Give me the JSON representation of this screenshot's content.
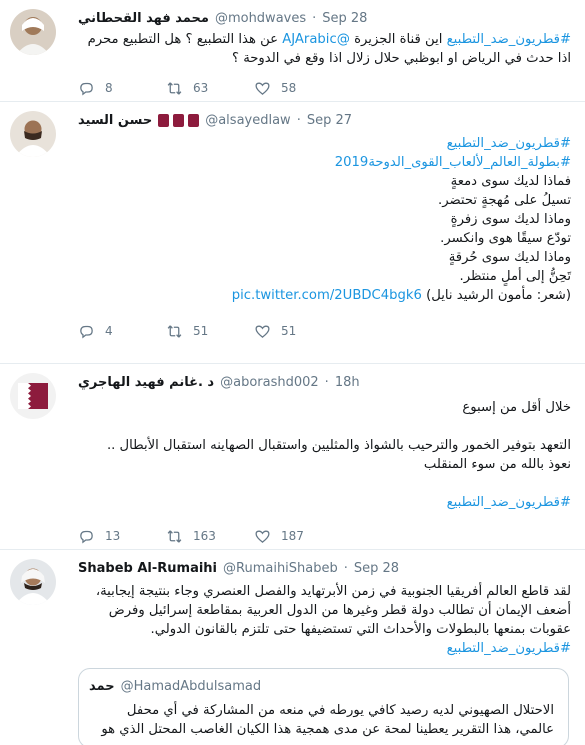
{
  "tweets": [
    {
      "name": "محمد فهد القحطاني",
      "handle": "@mohdwaves",
      "dot": "·",
      "time": "Sep 28",
      "lines": [
        {
          "a": "#قطريون_ضد_التطبيع",
          "b": " اين قناة الجزيرة ",
          "c": "@AJArabic",
          "d": " عن هذا التطبيع ؟ هل التطبيع محرم"
        },
        {
          "a": "",
          "b": "اذا حدث في الرياض او ابوظبي حلال زلال اذا وقع في الدوحة ؟",
          "c": "",
          "d": ""
        }
      ],
      "reply": "8",
      "retweet": "63",
      "like": "58"
    },
    {
      "name": "حسن السيد",
      "handle": "@alsayedlaw",
      "dot": "·",
      "time": "Sep 27",
      "lines": [
        {
          "a": "#قطريون_ضد_التطبيع",
          "b": "",
          "c": "",
          "d": ""
        },
        {
          "a": "#بطولة_العالم_لألعاب_القوى_الدوحة2019",
          "b": "",
          "c": "",
          "d": ""
        },
        {
          "a": "",
          "b": "فماذا لديك سوى دمعةٍ",
          "c": "",
          "d": ""
        },
        {
          "a": "",
          "b": "تسيلُ على مُهجةٍ تحتضر.",
          "c": "",
          "d": ""
        },
        {
          "a": "",
          "b": "وماذا لديك سوى زفرةٍ",
          "c": "",
          "d": ""
        },
        {
          "a": "",
          "b": "تودّع سيقًا هوى وانكسر.",
          "c": "",
          "d": ""
        },
        {
          "a": "",
          "b": "وماذا لديك سوى حُرقةٍ",
          "c": "",
          "d": ""
        },
        {
          "a": "",
          "b": "تَحِنُّ إلى أملٍ منتظر.",
          "c": "",
          "d": ""
        },
        {
          "a": "",
          "b": "(شعر: مأمون الرشيد نايل) ",
          "c": "pic.twitter.com/2UBDC4bgk6",
          "d": ""
        }
      ],
      "reply": "4",
      "retweet": "51",
      "like": "51"
    },
    {
      "name": "د .غانم فهيد الهاجري",
      "handle": "@aborashd002",
      "dot": "·",
      "time": "18h",
      "lines": [
        {
          "a": "",
          "b": "خلال أقل من إسبوع",
          "c": "",
          "d": ""
        },
        {
          "a": "",
          "b": "",
          "c": "",
          "d": ""
        },
        {
          "a": "",
          "b": "التعهد بتوفير الخمور والترحيب بالشواذ والمثليين واستقبال الصهاينه استقبال الأبطال ..",
          "c": "",
          "d": ""
        },
        {
          "a": "",
          "b": "نعوذ بالله من سوء المنقلب",
          "c": "",
          "d": ""
        },
        {
          "a": "",
          "b": "",
          "c": "",
          "d": ""
        },
        {
          "a": "#قطريون_ضد_التطبيع",
          "b": "",
          "c": "",
          "d": ""
        }
      ],
      "reply": "13",
      "retweet": "163",
      "like": "187"
    },
    {
      "name": "Shabeb Al-Rumaihi",
      "handle": "@RumaihiShabeb",
      "dot": "·",
      "time": "Sep 28",
      "lines": [
        {
          "a": "",
          "b": "لقد قاطع العالم أفريقيا الجنوبية في زمن الأبرتهايد والفصل العنصري وجاء بنتيجة إيجابية،",
          "c": "",
          "d": ""
        },
        {
          "a": "",
          "b": "أضعف الإيمان أن تطالب دولة قطر وغيرها من الدول العربية بمقاطعة إسرائيل وفرض",
          "c": "",
          "d": ""
        },
        {
          "a": "",
          "b": "عقوبات بمنعها بالبطولات والأحداث التي تستضيفها حتى تلتزم بالقانون الدولي.",
          "c": "",
          "d": ""
        },
        {
          "a": "#قطريون_ضد_التطبيع",
          "b": "",
          "c": "",
          "d": ""
        }
      ],
      "quote": {
        "name": "حمد",
        "handle": "@HamadAbdulsamad",
        "lines": [
          "الاحتلال الصهيوني لديه رصيد كافي يورطه في منعه من المشاركة في أي محفل",
          "عالمي، هذا التقرير يعطينا لمحة عن مدى همجية هذا الكيان الغاصب المحتل الذي هو"
        ]
      }
    }
  ],
  "colors": {
    "link": "#1b95e0",
    "muted": "#657786",
    "border": "#e6ecf0",
    "qatar": "#8d1b3d"
  },
  "icons": {
    "reply": "reply-icon",
    "retweet": "retweet-icon",
    "like": "heart-icon"
  }
}
